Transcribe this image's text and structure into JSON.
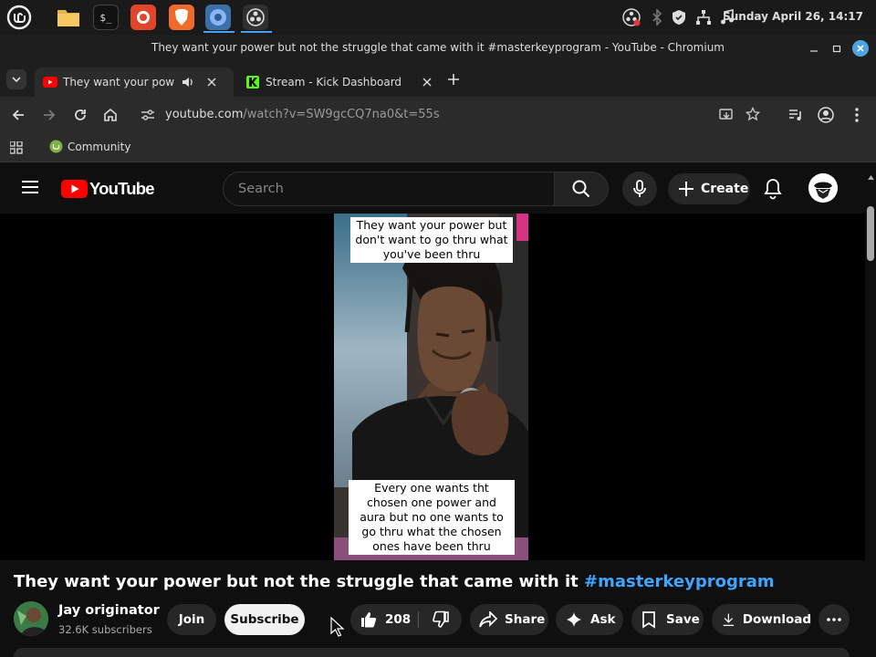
{
  "taskbar": {
    "clock": "Sunday April 26, 14:17",
    "apps": [
      "mint-menu-icon",
      "files-icon",
      "terminal-icon",
      "firefox-icon",
      "brave-icon",
      "chromium-icon",
      "obs-icon"
    ]
  },
  "window": {
    "title": "They want your power but not the struggle that came with it #masterkeyprogram - YouTube - Chromium"
  },
  "tabs": [
    {
      "title": "They want your power bu",
      "active": true
    },
    {
      "title": "Stream - Kick Dashboard",
      "active": false
    }
  ],
  "omnibox": {
    "host": "youtube.com",
    "path": "/watch?v=SW9gcCQ7na0&t=55s"
  },
  "bookmarks": [
    {
      "label": "Community"
    }
  ],
  "youtube": {
    "logo_text": "YouTube",
    "search_placeholder": "Search",
    "create_label": "Create"
  },
  "video": {
    "caption_top": "They want your power but don't want to go thru what you've been thru",
    "caption_bottom": "Every one wants tht chosen one power and aura but no one wants to go thru what the chosen ones have been thru",
    "title_text": "They want your power but not the struggle that came with it ",
    "title_hashtag": "#masterkeyprogram"
  },
  "channel": {
    "name": "Jay originator",
    "subscribers": "32.6K subscribers",
    "join_label": "Join",
    "subscribe_label": "Subscribe"
  },
  "actions": {
    "likes": "208",
    "share": "Share",
    "ask": "Ask",
    "save": "Save",
    "download": "Download"
  },
  "colors": {
    "accent_link": "#3ea6ff",
    "yt_red": "#ff0000",
    "kick_green": "#53fc18",
    "taskbar_active": "#4a9ff5"
  }
}
